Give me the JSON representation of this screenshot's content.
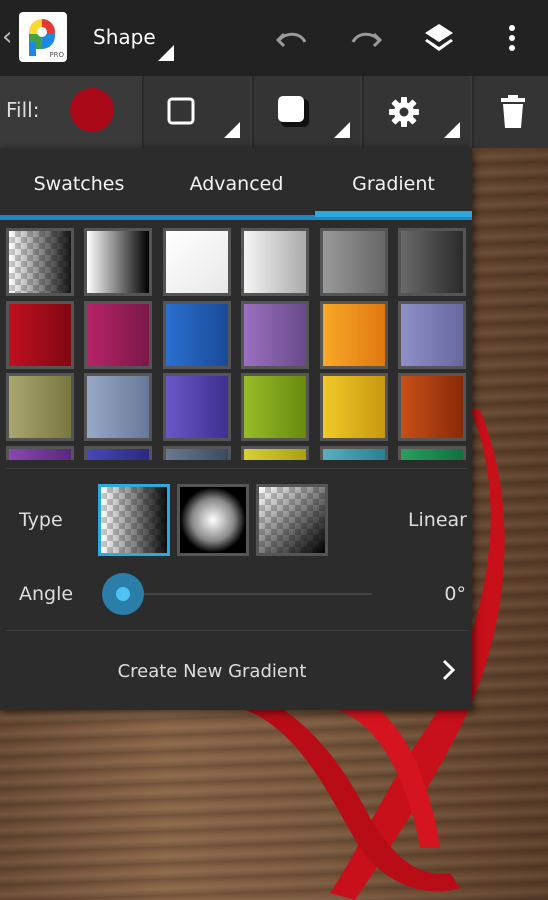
{
  "topbar": {
    "title": "Shape",
    "logo_badge": "PRO"
  },
  "toolbar": {
    "fill_label": "Fill:",
    "fill_color": "#aa0a18"
  },
  "panel": {
    "tabs": [
      {
        "label": "Swatches",
        "selected": false
      },
      {
        "label": "Advanced",
        "selected": false
      },
      {
        "label": "Gradient",
        "selected": true
      }
    ],
    "swatch_rows": [
      [
        "checker-fade",
        "#2a2a2a-white-fade",
        "white-fade",
        "light-grey",
        "mid-grey",
        "dark-grey"
      ],
      [
        "#b0101f",
        "#a8205f",
        "#1e62c2",
        "#8a5fae",
        "#f4a020",
        "#8080b8"
      ],
      [
        "#a09c60",
        "#8a98b8",
        "#5a4cb6",
        "#8aac20",
        "#e8c020",
        "#c04818"
      ],
      [
        "#7a40a0",
        "#3a3aa0",
        "#5a6a80",
        "#c8c030",
        "#4aa0b0",
        "#209050"
      ]
    ],
    "type": {
      "label": "Type",
      "value": "Linear",
      "options": [
        "linear",
        "radial",
        "sweep"
      ],
      "selected": "linear"
    },
    "angle": {
      "label": "Angle",
      "value": "0°"
    },
    "create_label": "Create New Gradient"
  },
  "colors": {
    "accent": "#29abe2",
    "panel_bg": "#2c2c2c",
    "topbar_bg": "#222222"
  }
}
